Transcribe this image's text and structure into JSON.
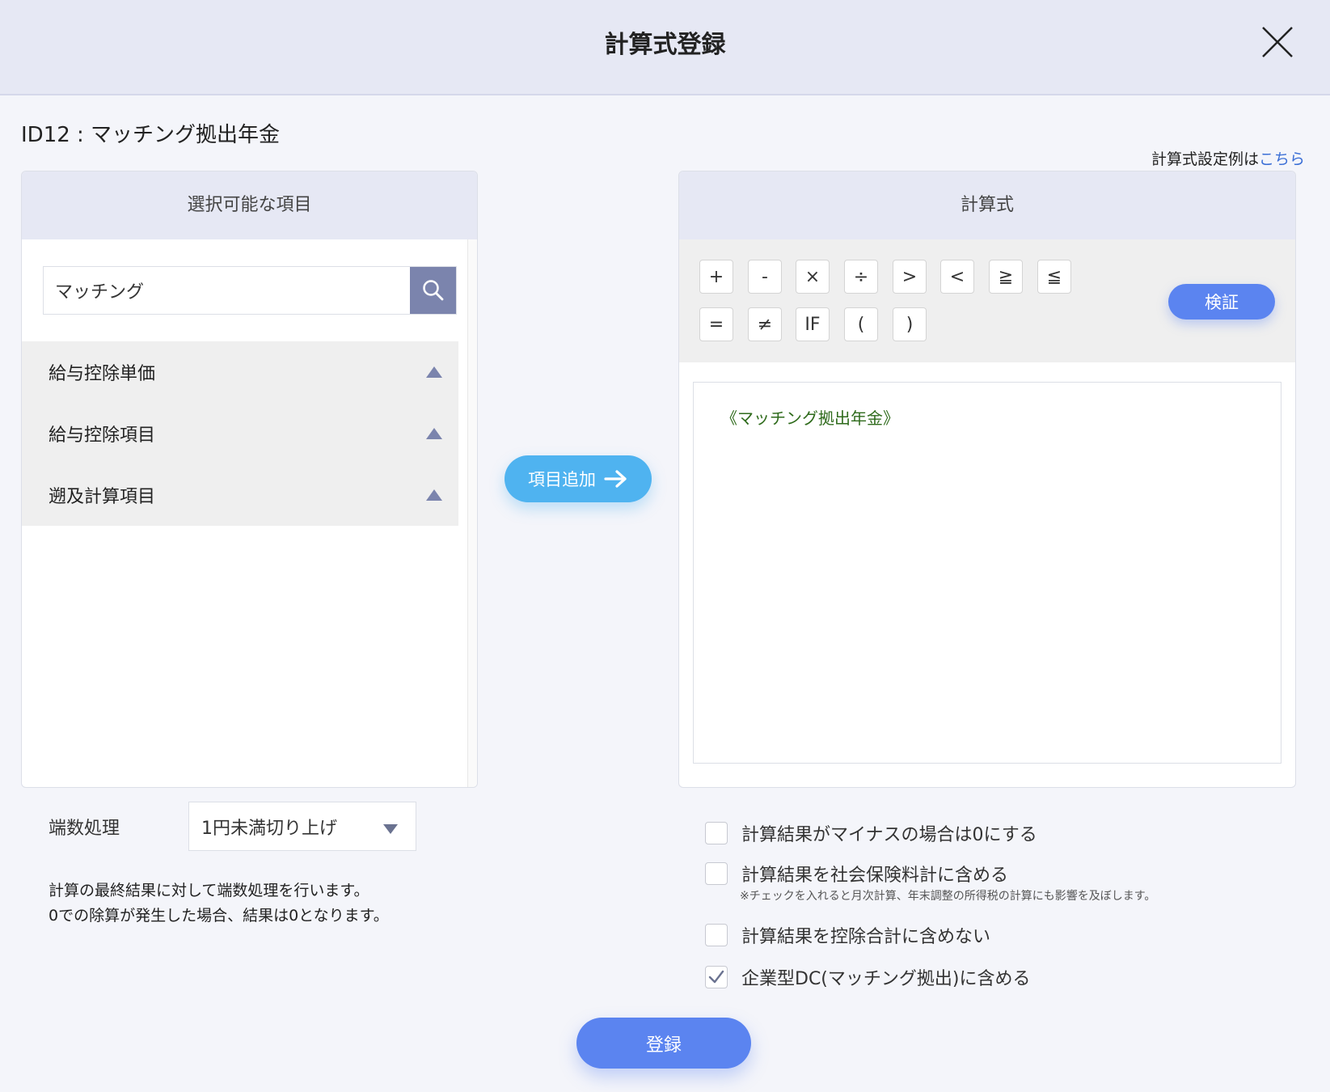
{
  "dialog": {
    "title": "計算式登録",
    "close_icon": "close-icon"
  },
  "record": {
    "title": "ID12 : マッチング拠出年金"
  },
  "example": {
    "prefix": "計算式設定例は",
    "link": "こちら"
  },
  "left_panel": {
    "header": "選択可能な項目",
    "search": {
      "value": "マッチング",
      "placeholder": ""
    },
    "items": [
      {
        "label": "給与控除単価"
      },
      {
        "label": "給与控除項目"
      },
      {
        "label": "遡及計算項目"
      }
    ]
  },
  "add_button": {
    "label": "項目追加"
  },
  "right_panel": {
    "header": "計算式",
    "operators": [
      "+",
      "-",
      "×",
      "÷",
      ">",
      "<",
      "≧",
      "≦",
      "=",
      "≠",
      "IF",
      "(",
      ")"
    ],
    "verify_label": "検証",
    "formula": "《マッチング拠出年金》"
  },
  "rounding": {
    "label": "端数処理",
    "selected": "1円未満切り上げ",
    "note_line1": "計算の最終結果に対して端数処理を行います。",
    "note_line2": "0での除算が発生した場合、結果は0となります。"
  },
  "options": [
    {
      "label": "計算結果がマイナスの場合は0にする",
      "checked": false
    },
    {
      "label": "計算結果を社会保険料計に含める",
      "checked": false
    },
    {
      "label": "計算結果を控除合計に含めない",
      "checked": false
    },
    {
      "label": "企業型DC(マッチング拠出)に含める",
      "checked": true
    }
  ],
  "options_note": "※チェックを入れると月次計算、年末調整の所得税の計算にも影響を及ぼします。",
  "submit": {
    "label": "登録"
  },
  "colors": {
    "accent": "#5b84f0",
    "add_button": "#4fb3f0",
    "search_button": "#7b84ad",
    "formula_text": "#2f6b1c"
  }
}
